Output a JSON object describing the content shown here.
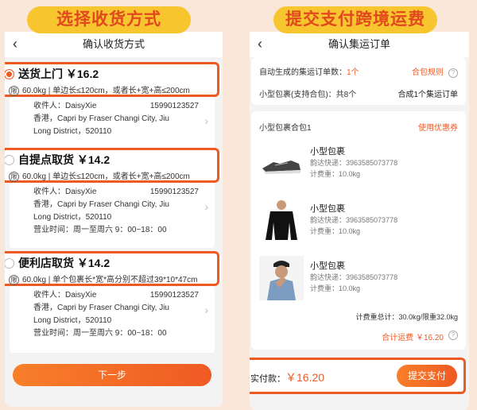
{
  "banners": {
    "left": "选择收货方式",
    "right": "提交支付跨境运费"
  },
  "left": {
    "title": "确认收货方式",
    "options": [
      {
        "name": "送货上门",
        "price": "￥16.2",
        "limit_badge": "限",
        "limit": "60.0kg | 单边长≤120cm，或者长+宽+高≤200cm",
        "selected": true,
        "recipient_label": "收件人：DaisyXie",
        "phone": "15990123527",
        "address_line1": "香港，Capri by Fraser Changi City, Jiu",
        "address_line2": "Long District，520110",
        "hours": ""
      },
      {
        "name": "自提点取货",
        "price": "￥14.2",
        "limit_badge": "限",
        "limit": "60.0kg | 单边长≤120cm，或者长+宽+高≤200cm",
        "selected": false,
        "recipient_label": "收件人：DaisyXie",
        "phone": "15990123527",
        "address_line1": "香港，Capri by Fraser Changi City, Jiu",
        "address_line2": "Long District，520110",
        "hours": "营业时间：周一至周六 9：00~18：00"
      },
      {
        "name": "便利店取货",
        "price": "￥14.2",
        "limit_badge": "限",
        "limit": "60.0kg | 单个包裹长*宽*高分别不超过39*10*47cm",
        "selected": false,
        "recipient_label": "收件人：DaisyXie",
        "phone": "15990123527",
        "address_line1": "香港，Capri by Fraser Changi City, Jiu",
        "address_line2": "Long District，520110",
        "hours": "营业时间：周一至周六 9：00~18：00"
      }
    ],
    "next_button": "下一步"
  },
  "right": {
    "title": "确认集运订单",
    "summary": {
      "generated_label": "自动生成的集运订单数：",
      "generated_count": "1个",
      "rules_link": "合包规则",
      "help_glyph": "?",
      "package_type": "小型包裹(支持合包)：共8个",
      "merge_result": "合成1个集运订单"
    },
    "group": {
      "title": "小型包裹合包1",
      "coupon_link": "使用优惠券",
      "items": [
        {
          "name": "小型包裹",
          "courier": "韵达快递：3963585073778",
          "weight": "计费重：10.0kg",
          "icon": "shoe-icon"
        },
        {
          "name": "小型包裹",
          "courier": "韵达快递：3963585073778",
          "weight": "计费重：10.0kg",
          "icon": "shirt-icon"
        },
        {
          "name": "小型包裹",
          "courier": "韵达快递：3963585073778",
          "weight": "计费重：10.0kg",
          "icon": "person-icon"
        }
      ],
      "weight_summary": "计费重总计：30.0kg/限重32.0kg",
      "total_label": "合计运费",
      "total_value": "￥16.20"
    },
    "pay": {
      "label": "实付款：",
      "amount": "￥16.20",
      "submit": "提交支付"
    }
  },
  "colors": {
    "accent": "#ee5a24",
    "banner": "#f7c62f"
  }
}
